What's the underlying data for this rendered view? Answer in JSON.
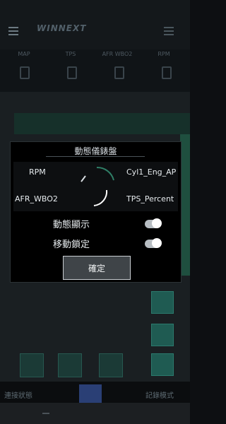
{
  "header": {
    "logo_text": "WINNEXT",
    "gauge_tabs": [
      "MAP",
      "TPS",
      "AFR WBO2",
      "RPM"
    ]
  },
  "dialog": {
    "title": "動態儀錶盤",
    "gauges": [
      {
        "left": "RPM",
        "right": "Cyl1_Eng_AP"
      },
      {
        "left": "AFR_WBO2",
        "right": "TPS_Percent"
      }
    ],
    "toggles": [
      {
        "label": "動態顯示",
        "state": "on"
      },
      {
        "label": "移動鎖定",
        "state": "on"
      }
    ],
    "ok_label": "確定"
  },
  "footer": {
    "left_text": "連接狀態",
    "right_text": "記錄模式"
  },
  "colors": {
    "accent": "#1f5b52",
    "background": "#0d0f12",
    "dialog_bg": "#000000"
  }
}
